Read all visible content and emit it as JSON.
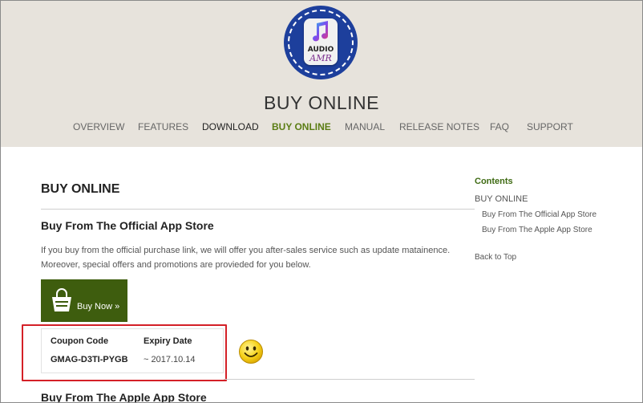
{
  "header": {
    "logo": {
      "line1": "AUDIO",
      "line2": "AMR",
      "icon": "music-note-icon"
    },
    "title": "BUY ONLINE",
    "nav": [
      "OVERVIEW",
      "FEATURES",
      "DOWNLOAD",
      "BUY ONLINE",
      "MANUAL",
      "RELEASE NOTES",
      "FAQ",
      "SUPPORT"
    ],
    "active_nav": "BUY ONLINE"
  },
  "main": {
    "page_heading": "BUY ONLINE",
    "official_heading": "Buy From The Official App Store",
    "official_text": "If you buy from the official purchase link, we will offer you after-sales service such as update matainence. Moreover, special offers and promotions are provieded for you below.",
    "buy_button": {
      "label": "Buy Now",
      "icon": "shopping-bag-icon"
    },
    "coupon": {
      "headers": [
        "Coupon Code",
        "Expiry Date"
      ],
      "code": "GMAG-D3TI-PYGB",
      "expiry": "~ 2017.10.14"
    },
    "emoji": "smiley-face-icon",
    "apple_heading": "Buy From The Apple App Store"
  },
  "sidebar": {
    "title": "Contents",
    "main_link": "BUY ONLINE",
    "sub_links": [
      "Buy From The Official App Store",
      "Buy From The Apple App Store"
    ],
    "back_to_top": "Back to Top"
  },
  "colors": {
    "header_bg": "#e7e3dc",
    "accent_green": "#5b7d14",
    "button_green": "#3e5d0e",
    "logo_blue": "#1d3f9c",
    "highlight_red": "#d42027"
  }
}
